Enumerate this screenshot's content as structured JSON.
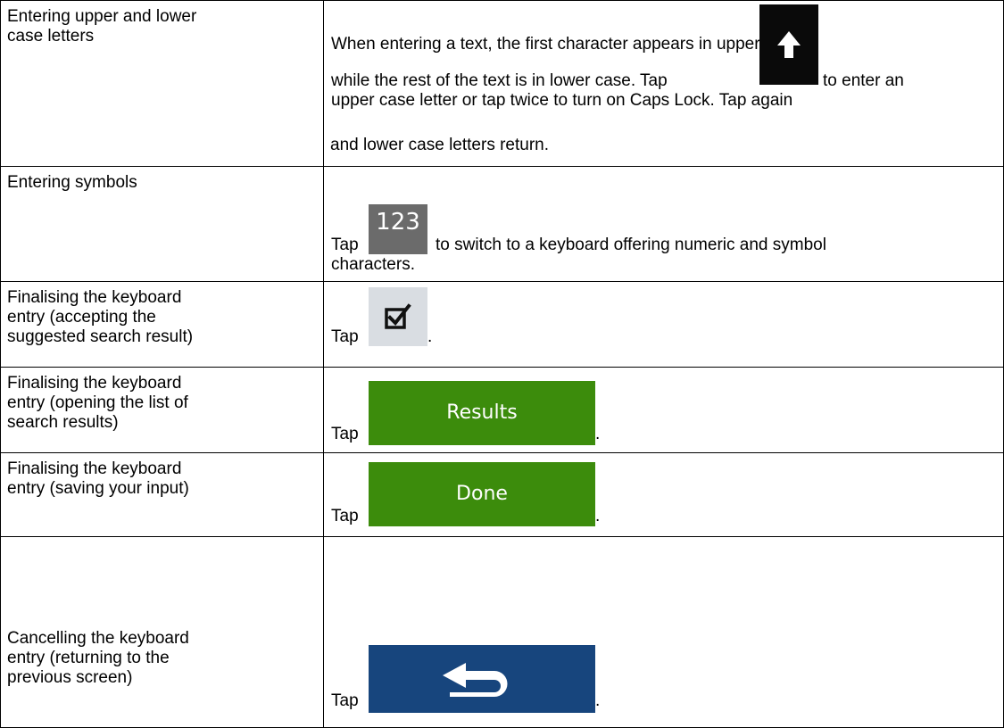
{
  "rows": [
    {
      "label": "Entering upper and lower\ncase letters",
      "line1": "When entering a text, the first character appears in upper case",
      "line2a": "while the rest of the text is in lower case. Tap",
      "line2b": "to enter an",
      "line3": "upper case letter or tap twice to turn on Caps Lock. Tap again",
      "line4": "and lower case letters return.",
      "icon": "up-arrow-icon"
    },
    {
      "label": "Entering symbols",
      "tap": "Tap",
      "icon_text": "123",
      "rest": "to switch to a keyboard offering numeric and symbol",
      "line2": "characters."
    },
    {
      "label": "Finalising the keyboard\nentry (accepting the\nsuggested search result)",
      "tap": "Tap",
      "icon": "checkbox-icon",
      "end": "."
    },
    {
      "label": "Finalising the keyboard\nentry (opening the list of\nsearch results)",
      "tap": "Tap",
      "button_label": "Results",
      "end": "."
    },
    {
      "label": "Finalising the keyboard\nentry (saving your input)",
      "tap": "Tap",
      "button_label": "Done",
      "end": "."
    },
    {
      "label": "Cancelling the keyboard\nentry (returning to the\nprevious screen)",
      "tap": "Tap",
      "icon": "back-arrow-icon",
      "end": "."
    }
  ],
  "colors": {
    "green_button": "#3c8c0c",
    "blue_button": "#17457d",
    "gray_123": "#6b6b6b"
  }
}
